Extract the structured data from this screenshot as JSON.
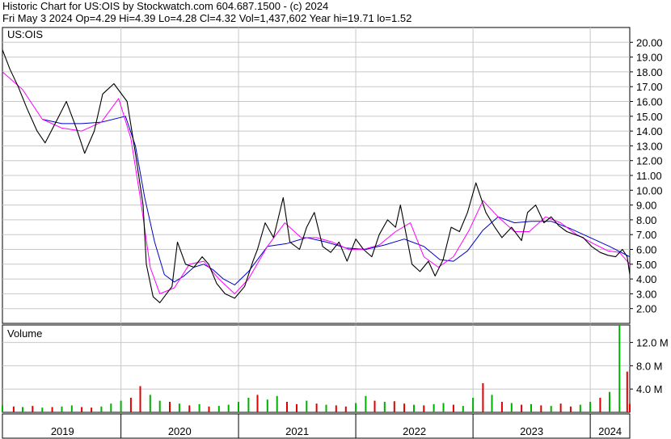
{
  "header": {
    "title": "Historic Chart for US:OIS by Stockwatch.com 604.687.1500 - (c) 2024",
    "summary": "Fri May  3 2024  Op=4.29  Hi=4.39  Lo=4.28  Cl=4.32  Vol=1,437,602  Year hi=19.71  lo=1.52"
  },
  "colors": {
    "price": "#000000",
    "ma_short": "#ff00ff",
    "ma_long": "#0000c8",
    "vol_up": "#00b000",
    "vol_down": "#e00000",
    "grid": "#c8c8c8",
    "frame": "#000000"
  },
  "chart_data": [
    {
      "type": "line",
      "symbol": "US:OIS",
      "y_axis_side": "right",
      "ylim": [
        1.0,
        21.0
      ],
      "yticks": [
        "20.00",
        "19.00",
        "18.00",
        "17.00",
        "16.00",
        "15.00",
        "14.00",
        "13.00",
        "12.00",
        "11.00",
        "10.00",
        "9.00",
        "8.00",
        "7.00",
        "6.00",
        "5.00",
        "4.00",
        "3.00",
        "2.00"
      ],
      "x_labels": [
        "2019",
        "2020",
        "2021",
        "2022",
        "2023",
        "2024"
      ],
      "grid": true,
      "series": [
        {
          "role": "price",
          "x": [
            "2018-12-28",
            "2019-01-20",
            "2019-02-15",
            "2019-03-15",
            "2019-04-15",
            "2019-05-10",
            "2019-06-10",
            "2019-07-15",
            "2019-08-15",
            "2019-09-10",
            "2019-10-10",
            "2019-11-05",
            "2019-12-10",
            "2020-01-20",
            "2020-02-15",
            "2020-03-10",
            "2020-03-20",
            "2020-04-10",
            "2020-05-01",
            "2020-06-08",
            "2020-06-25",
            "2020-07-20",
            "2020-08-15",
            "2020-09-10",
            "2020-09-30",
            "2020-10-25",
            "2020-11-20",
            "2020-12-20",
            "2021-01-20",
            "2021-02-15",
            "2021-03-01",
            "2021-03-25",
            "2021-04-20",
            "2021-05-20",
            "2021-06-10",
            "2021-07-10",
            "2021-08-01",
            "2021-08-25",
            "2021-09-20",
            "2021-10-15",
            "2021-11-10",
            "2021-12-05",
            "2022-01-01",
            "2022-01-25",
            "2022-02-20",
            "2022-03-15",
            "2022-04-10",
            "2022-05-05",
            "2022-05-20",
            "2022-06-25",
            "2022-07-20",
            "2022-08-15",
            "2022-09-05",
            "2022-09-30",
            "2022-10-25",
            "2022-11-20",
            "2022-12-15",
            "2023-01-10",
            "2023-02-10",
            "2023-03-10",
            "2023-04-01",
            "2023-05-01",
            "2023-06-01",
            "2023-06-20",
            "2023-07-15",
            "2023-08-10",
            "2023-09-01",
            "2023-09-25",
            "2023-10-20",
            "2023-11-15",
            "2023-12-10",
            "2024-01-05",
            "2024-02-01",
            "2024-02-25",
            "2024-03-20",
            "2024-04-10",
            "2024-04-25",
            "2024-05-03"
          ],
          "values": [
            19.5,
            18.2,
            17.0,
            15.5,
            14.0,
            13.2,
            14.5,
            16.0,
            14.2,
            12.5,
            14.0,
            16.5,
            17.2,
            16.0,
            12.5,
            9.0,
            5.0,
            2.8,
            2.4,
            3.5,
            6.5,
            5.0,
            4.8,
            5.5,
            5.0,
            3.7,
            3.0,
            2.7,
            3.5,
            5.2,
            6.0,
            7.8,
            6.8,
            9.5,
            6.5,
            6.0,
            7.5,
            8.5,
            6.2,
            5.8,
            6.5,
            5.2,
            6.7,
            6.0,
            5.5,
            7.0,
            8.0,
            7.5,
            9.0,
            5.0,
            4.5,
            5.2,
            4.2,
            5.3,
            7.5,
            7.2,
            8.5,
            10.5,
            8.5,
            7.5,
            6.8,
            7.5,
            6.6,
            8.5,
            9.0,
            7.8,
            8.2,
            7.6,
            7.2,
            7.0,
            6.8,
            6.2,
            5.8,
            5.6,
            5.5,
            6.0,
            5.5,
            4.3
          ]
        },
        {
          "role": "short moving average",
          "x": [
            "2018-12-28",
            "2019-03-01",
            "2019-05-01",
            "2019-07-01",
            "2019-09-01",
            "2019-11-01",
            "2019-12-25",
            "2020-02-01",
            "2020-03-01",
            "2020-04-01",
            "2020-05-01",
            "2020-06-15",
            "2020-08-01",
            "2020-09-15",
            "2020-11-01",
            "2020-12-20",
            "2021-02-01",
            "2021-04-01",
            "2021-05-25",
            "2021-07-15",
            "2021-09-01",
            "2021-10-20",
            "2021-12-10",
            "2022-01-25",
            "2022-03-15",
            "2022-05-05",
            "2022-06-20",
            "2022-08-01",
            "2022-09-15",
            "2022-11-01",
            "2022-12-20",
            "2023-02-01",
            "2023-03-20",
            "2023-05-10",
            "2023-06-25",
            "2023-08-15",
            "2023-10-01",
            "2023-11-20",
            "2024-01-10",
            "2024-02-25",
            "2024-04-01",
            "2024-05-03"
          ],
          "values": [
            18.0,
            16.8,
            14.8,
            14.2,
            14.0,
            14.6,
            16.2,
            13.5,
            9.5,
            4.8,
            3.0,
            3.4,
            5.0,
            5.2,
            4.0,
            3.0,
            4.0,
            6.2,
            7.8,
            6.8,
            6.8,
            6.5,
            6.0,
            6.0,
            6.3,
            7.2,
            7.8,
            5.5,
            4.8,
            5.5,
            7.3,
            9.3,
            8.2,
            7.2,
            7.2,
            8.2,
            7.8,
            7.0,
            6.4,
            5.9,
            5.8,
            5.0
          ]
        },
        {
          "role": "long moving average",
          "x": [
            "2019-05-01",
            "2019-07-01",
            "2019-09-01",
            "2019-11-01",
            "2020-01-15",
            "2020-02-15",
            "2020-03-15",
            "2020-04-15",
            "2020-05-15",
            "2020-06-15",
            "2020-07-15",
            "2020-08-15",
            "2020-09-15",
            "2020-10-15",
            "2020-11-15",
            "2020-12-20",
            "2021-02-01",
            "2021-04-01",
            "2021-06-01",
            "2021-08-01",
            "2021-10-01",
            "2021-12-01",
            "2022-02-01",
            "2022-04-01",
            "2022-06-01",
            "2022-08-01",
            "2022-09-20",
            "2022-11-01",
            "2022-12-15",
            "2023-02-01",
            "2023-03-20",
            "2023-05-10",
            "2023-07-01",
            "2023-09-01",
            "2023-11-01",
            "2024-01-01",
            "2024-03-01",
            "2024-05-03"
          ],
          "values": [
            14.8,
            14.5,
            14.5,
            14.6,
            15.0,
            13.0,
            9.5,
            6.5,
            4.3,
            3.8,
            4.2,
            4.8,
            5.0,
            4.6,
            4.0,
            3.6,
            4.5,
            6.2,
            6.4,
            6.8,
            6.5,
            6.1,
            6.0,
            6.3,
            6.7,
            6.2,
            5.3,
            5.2,
            5.9,
            7.3,
            8.2,
            7.8,
            7.9,
            7.9,
            7.4,
            6.8,
            6.2,
            5.5
          ]
        }
      ]
    },
    {
      "type": "bar",
      "title": "Volume",
      "y_axis_side": "right",
      "ylim": [
        0,
        15000000
      ],
      "yticks": [
        "12.0 M",
        "8.0 M",
        "4.0 M"
      ],
      "grid": true,
      "x": [
        "2018-12-28",
        "2019-02-01",
        "2019-03-01",
        "2019-04-01",
        "2019-05-01",
        "2019-06-01",
        "2019-07-01",
        "2019-08-01",
        "2019-09-01",
        "2019-10-01",
        "2019-11-01",
        "2019-12-01",
        "2020-01-01",
        "2020-02-01",
        "2020-03-01",
        "2020-04-01",
        "2020-05-01",
        "2020-06-01",
        "2020-07-01",
        "2020-08-01",
        "2020-09-01",
        "2020-10-01",
        "2020-11-01",
        "2020-12-01",
        "2021-01-01",
        "2021-02-01",
        "2021-03-01",
        "2021-04-01",
        "2021-05-01",
        "2021-06-01",
        "2021-07-01",
        "2021-08-01",
        "2021-09-01",
        "2021-10-01",
        "2021-11-01",
        "2021-12-01",
        "2022-01-01",
        "2022-02-01",
        "2022-03-01",
        "2022-04-01",
        "2022-05-01",
        "2022-06-01",
        "2022-07-01",
        "2022-08-01",
        "2022-09-01",
        "2022-10-01",
        "2022-11-01",
        "2022-12-01",
        "2023-01-01",
        "2023-02-01",
        "2023-03-01",
        "2023-04-01",
        "2023-05-01",
        "2023-06-01",
        "2023-07-01",
        "2023-08-01",
        "2023-09-01",
        "2023-10-01",
        "2023-11-01",
        "2023-12-01",
        "2024-01-01",
        "2024-02-01",
        "2024-03-01",
        "2024-04-01",
        "2024-04-25",
        "2024-05-03"
      ],
      "values": [
        1200000,
        1000000,
        900000,
        1100000,
        800000,
        900000,
        1000000,
        1200000,
        900000,
        800000,
        1000000,
        1500000,
        2000000,
        2500000,
        4500000,
        3000000,
        2000000,
        1800000,
        1500000,
        1200000,
        1400000,
        1000000,
        1100000,
        1300000,
        1800000,
        2500000,
        3000000,
        2200000,
        2800000,
        1800000,
        1400000,
        2000000,
        1500000,
        1300000,
        1200000,
        1000000,
        1600000,
        2800000,
        2000000,
        1800000,
        1900000,
        1500000,
        1300000,
        1200000,
        1400000,
        1600000,
        1300000,
        1100000,
        2500000,
        5000000,
        3000000,
        1800000,
        1600000,
        1300000,
        1400000,
        1200000,
        1100000,
        1500000,
        1000000,
        1300000,
        1800000,
        2500000,
        3500000,
        15000000,
        7000000,
        1437602
      ],
      "up": [
        true,
        false,
        true,
        false,
        true,
        false,
        true,
        true,
        false,
        false,
        true,
        true,
        true,
        false,
        false,
        true,
        true,
        false,
        true,
        false,
        true,
        false,
        true,
        true,
        true,
        true,
        false,
        true,
        true,
        false,
        false,
        true,
        false,
        true,
        false,
        false,
        true,
        true,
        false,
        true,
        false,
        false,
        true,
        false,
        true,
        true,
        false,
        true,
        true,
        false,
        true,
        false,
        true,
        false,
        true,
        false,
        true,
        false,
        false,
        true,
        true,
        false,
        true,
        true,
        false,
        false
      ]
    }
  ]
}
